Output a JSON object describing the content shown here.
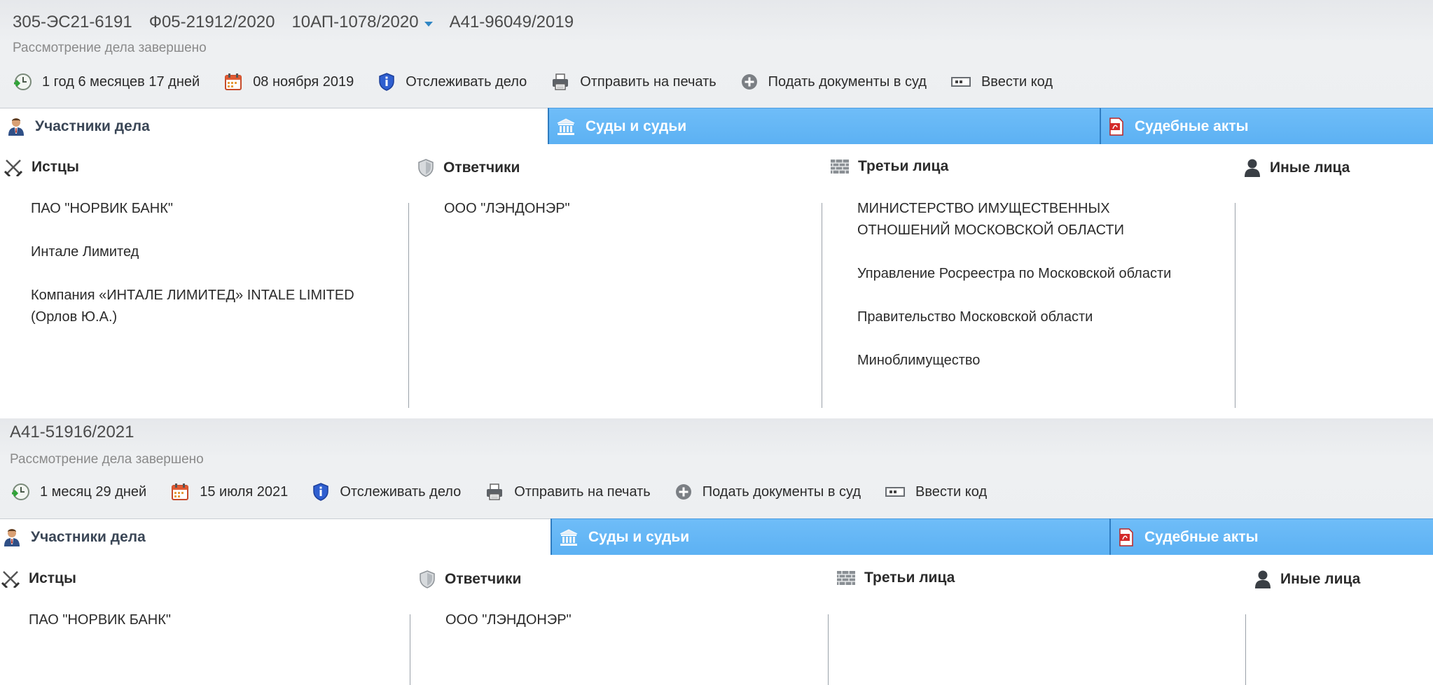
{
  "cases": [
    {
      "numbers": [
        "305-ЭС21-6191",
        "Ф05-21912/2020",
        "10АП-1078/2020",
        "А41-96049/2019"
      ],
      "status": "Рассмотрение дела завершено",
      "toolbar": {
        "duration": "1 год 6 месяцев 17 дней",
        "date": "08 ноября 2019",
        "track": "Отслеживать дело",
        "print": "Отправить на печать",
        "submit": "Подать документы в суд",
        "code": "Ввести код"
      },
      "tabs": [
        "Участники дела",
        "Суды и судьи",
        "Судебные акты"
      ],
      "columns": {
        "plaintiffs": {
          "title": "Истцы",
          "items": [
            "ПАО \"НОРВИК БАНК\"",
            "Интале Лимитед",
            "Компания «ИНТАЛЕ ЛИМИТЕД» INTALE LIMITED (Орлов Ю.А.)"
          ]
        },
        "defendants": {
          "title": "Ответчики",
          "items": [
            "ООО \"ЛЭНДОНЭР\""
          ]
        },
        "third_parties": {
          "title": "Третьи лица",
          "items": [
            "МИНИСТЕРСТВО ИМУЩЕСТВЕННЫХ ОТНОШЕНИЙ МОСКОВСКОЙ ОБЛАСТИ",
            "Управление Росреестра по Московской области",
            "Правительство Московской области",
            "Миноблимущество"
          ]
        },
        "others": {
          "title": "Иные лица",
          "items": []
        }
      }
    },
    {
      "numbers": [
        "А41-51916/2021"
      ],
      "status": "Рассмотрение дела завершено",
      "toolbar": {
        "duration": "1 месяц 29 дней",
        "date": "15 июля 2021",
        "track": "Отслеживать дело",
        "print": "Отправить на печать",
        "submit": "Подать документы в суд",
        "code": "Ввести код"
      },
      "tabs": [
        "Участники дела",
        "Суды и судьи",
        "Судебные акты"
      ],
      "columns": {
        "plaintiffs": {
          "title": "Истцы",
          "items": [
            "ПАО \"НОРВИК БАНК\""
          ]
        },
        "defendants": {
          "title": "Ответчики",
          "items": [
            "ООО \"ЛЭНДОНЭР\""
          ]
        },
        "third_parties": {
          "title": "Третьи лица",
          "items": []
        },
        "others": {
          "title": "Иные лица",
          "items": []
        }
      }
    }
  ],
  "icons": {
    "duration": "clock-back-icon",
    "date": "calendar-icon",
    "track": "shield-info-icon",
    "print": "printer-icon",
    "submit": "plus-circle-icon",
    "code": "code-card-icon",
    "participants": "person-tie-icon",
    "courts": "courthouse-icon",
    "acts": "pdf-icon",
    "plaintiffs": "crossed-swords-icon",
    "defendants": "shield-icon",
    "third_parties": "brick-wall-icon",
    "others": "person-icon"
  },
  "colors": {
    "tab_blue": "#5cb1f3",
    "header_bg": "#e9ebee",
    "link_caret": "#2f86c4"
  }
}
